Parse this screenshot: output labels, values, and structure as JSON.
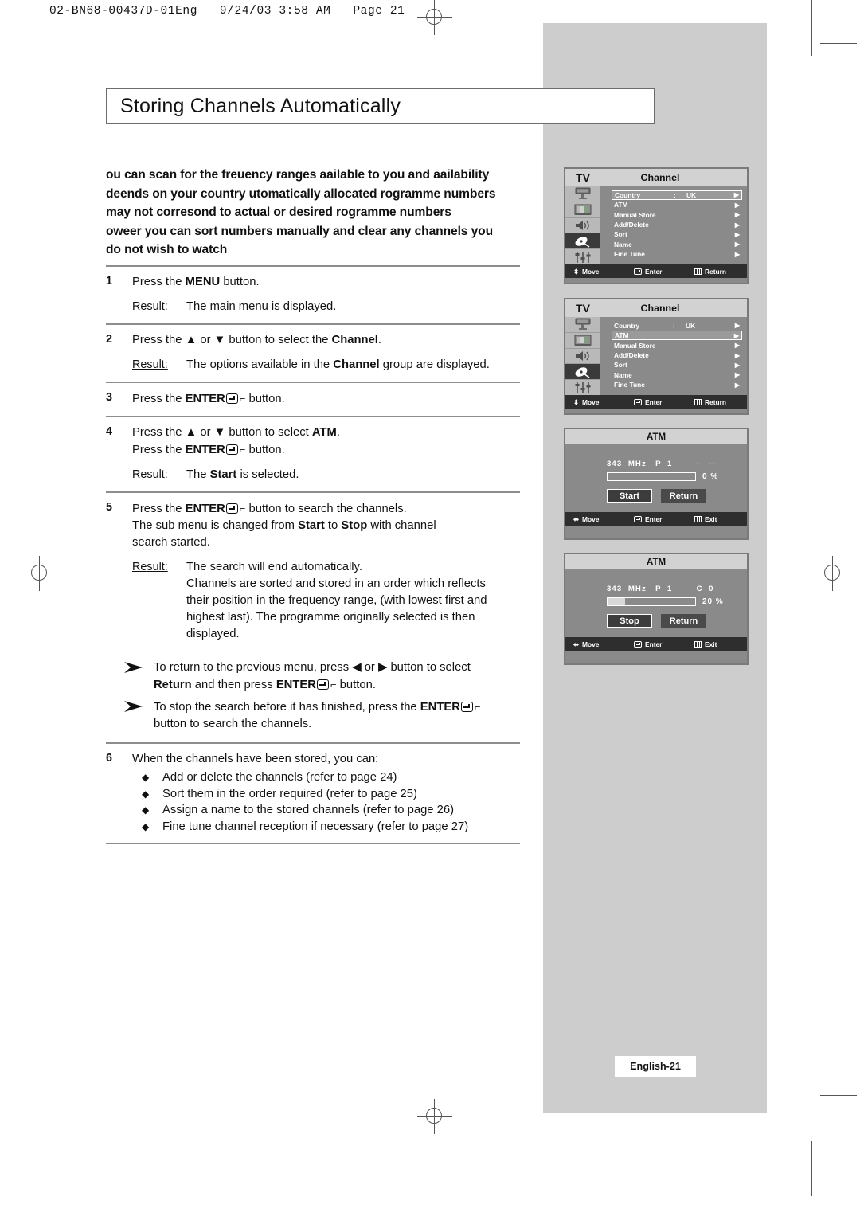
{
  "slug": "02-BN68-00437D-01Eng   9/24/03 3:58 AM   Page 21",
  "title": "Storing Channels Automatically",
  "intro_lines": [
    "ou can scan for the freuency ranges aailable to you and aailability",
    "deends on your country utomatically allocated rogramme numbers",
    "may not corresond to actual or desired rogramme numbers",
    "oweer you can sort numbers manually and clear any channels you",
    "do not wish to watch"
  ],
  "steps": [
    {
      "num": "1",
      "lines": [
        {
          "text_before": "Press the ",
          "bold": "MENU",
          "text_after": " button."
        }
      ],
      "result_label": "Result:",
      "result_lines": [
        {
          "text_before": "The main menu is displayed.",
          "bold": "",
          "text_after": ""
        }
      ]
    },
    {
      "num": "2",
      "lines": [
        {
          "text_before": "Press the ▲ or ▼ button to select the ",
          "bold": "Channel",
          "text_after": "."
        }
      ],
      "result_label": "Result:",
      "result_lines": [
        {
          "text_before": "The options available in the ",
          "bold": "Channel",
          "text_after": " group are displayed."
        }
      ]
    },
    {
      "num": "3",
      "lines": [
        {
          "text_before": "Press the ",
          "bold": "ENTER",
          "enter_icon": true,
          "text_after": " button."
        }
      ],
      "result_label": "",
      "result_lines": []
    },
    {
      "num": "4",
      "lines": [
        {
          "text_before": "Press the ▲ or ▼ button to select ",
          "bold": "ATM",
          "text_after": "."
        },
        {
          "text_before": "Press the ",
          "bold": "ENTER",
          "enter_icon": true,
          "text_after": " button."
        }
      ],
      "result_label": "Result:",
      "result_lines": [
        {
          "text_before": "The ",
          "bold": "Start",
          "text_after": " is selected."
        }
      ]
    },
    {
      "num": "5",
      "lines": [
        {
          "text_before": "Press the ",
          "bold": "ENTER",
          "enter_icon": true,
          "text_after": " button to search the channels."
        },
        {
          "text_before": "The sub menu is changed from ",
          "bold": "Start",
          "text_after": " to ",
          "bold2": "Stop",
          "text_after2": " with channel"
        },
        {
          "text_before": "search started.",
          "bold": "",
          "text_after": ""
        }
      ],
      "result_label": "Result:",
      "result_lines": [
        {
          "text_before": "The search will end automatically.",
          "bold": "",
          "text_after": ""
        },
        {
          "text_before": "Channels are sorted and stored in an order which reflects",
          "bold": "",
          "text_after": ""
        },
        {
          "text_before": "their position in the frequency range, (with lowest first and",
          "bold": "",
          "text_after": ""
        },
        {
          "text_before": "highest last). The programme originally selected is then",
          "bold": "",
          "text_after": ""
        },
        {
          "text_before": "displayed.",
          "bold": "",
          "text_after": ""
        }
      ]
    }
  ],
  "notes": [
    {
      "line1_before": "To return to the previous menu, press ◀ or ▶ button to select",
      "line2_bold": "Return",
      "line2_mid": " and then press ",
      "line2_bold2": "ENTER",
      "line2_after": " button."
    },
    {
      "line1_before": "To stop the search before it has finished, press the ",
      "line1_bold": "ENTER",
      "line2_after": "button to search the channels."
    }
  ],
  "step6": {
    "num": "6",
    "heading": "When the channels have been stored, you can:",
    "bullets": [
      "Add or delete the channels (refer to page 24)",
      "Sort them in the order required (refer to page 25)",
      "Assign a name to the stored channels (refer to page 26)",
      "Fine tune channel reception if necessary (refer to page 27)"
    ]
  },
  "osd_menus": [
    {
      "tv_label": "TV",
      "group_title": "Channel",
      "rows": [
        {
          "label": "Country",
          "colon": ":",
          "value": "UK",
          "arrow": "▶",
          "selected": true
        },
        {
          "label": "ATM",
          "colon": "",
          "value": "",
          "arrow": "▶",
          "selected": false
        },
        {
          "label": "Manual Store",
          "colon": "",
          "value": "",
          "arrow": "▶",
          "selected": false
        },
        {
          "label": "Add/Delete",
          "colon": "",
          "value": "",
          "arrow": "▶",
          "selected": false
        },
        {
          "label": "Sort",
          "colon": "",
          "value": "",
          "arrow": "▶",
          "selected": false
        },
        {
          "label": "Name",
          "colon": "",
          "value": "",
          "arrow": "▶",
          "selected": false
        },
        {
          "label": "Fine Tune",
          "colon": "",
          "value": "",
          "arrow": "▶",
          "selected": false
        }
      ],
      "footer": {
        "move": "Move",
        "enter": "Enter",
        "exit": "Return"
      }
    },
    {
      "tv_label": "TV",
      "group_title": "Channel",
      "rows": [
        {
          "label": "Country",
          "colon": ":",
          "value": "UK",
          "arrow": "▶",
          "selected": false
        },
        {
          "label": "ATM",
          "colon": "",
          "value": "",
          "arrow": "▶",
          "selected": true
        },
        {
          "label": "Manual Store",
          "colon": "",
          "value": "",
          "arrow": "▶",
          "selected": false
        },
        {
          "label": "Add/Delete",
          "colon": "",
          "value": "",
          "arrow": "▶",
          "selected": false
        },
        {
          "label": "Sort",
          "colon": "",
          "value": "",
          "arrow": "▶",
          "selected": false
        },
        {
          "label": "Name",
          "colon": "",
          "value": "",
          "arrow": "▶",
          "selected": false
        },
        {
          "label": "Fine Tune",
          "colon": "",
          "value": "",
          "arrow": "▶",
          "selected": false
        }
      ],
      "footer": {
        "move": "Move",
        "enter": "Enter",
        "exit": "Return"
      }
    }
  ],
  "atm_dialogs": [
    {
      "title": "ATM",
      "freq": "343  MHz   P  1        -   --",
      "progress": 0,
      "percent": "0  %",
      "primary_button": "Start",
      "secondary_button": "Return",
      "footer": {
        "move": "Move",
        "enter": "Enter",
        "exit": "Exit"
      }
    },
    {
      "title": "ATM",
      "freq": "343  MHz   P  1        C  0",
      "progress": 20,
      "percent": "20  %",
      "primary_button": "Stop",
      "secondary_button": "Return",
      "footer": {
        "move": "Move",
        "enter": "Enter",
        "exit": "Exit"
      }
    }
  ],
  "page_badge": "English-21",
  "colors": {
    "panel_gray": "#cdcdcd",
    "osd_bg": "#8a8a8a",
    "osd_header": "#d2d2d2",
    "osd_footer": "#2e2e2e"
  }
}
